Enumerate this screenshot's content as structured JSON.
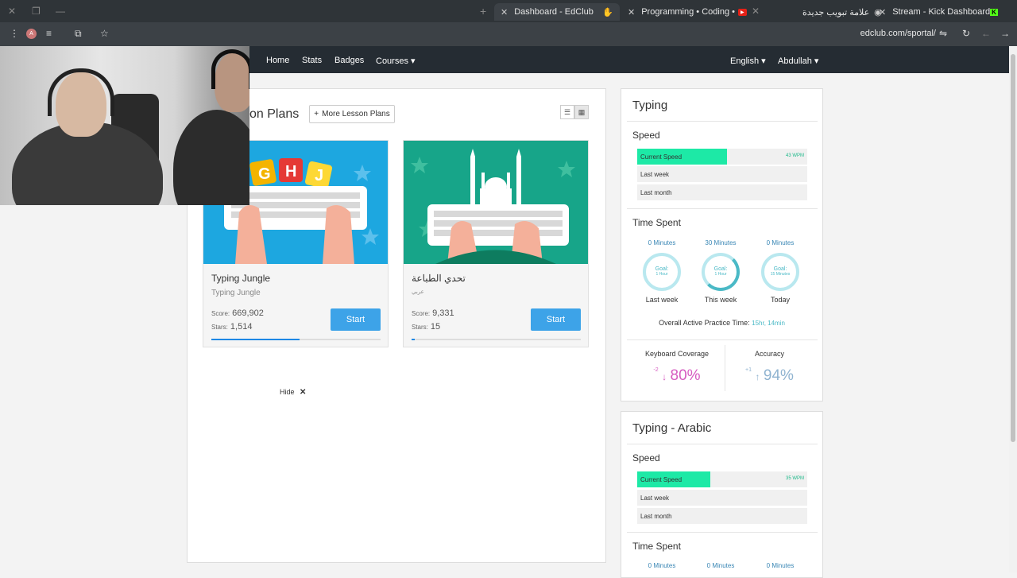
{
  "browser": {
    "tabs": [
      {
        "label": "Dashboard - EdClub",
        "active": true
      },
      {
        "label": "Programming  •  Coding  •",
        "active": false
      },
      {
        "label": "علامة تبويب جديدة",
        "active": false
      },
      {
        "label": "Stream - Kick Dashboard",
        "active": false
      }
    ],
    "url": "edclub.com/sportal/"
  },
  "nav": {
    "home": "Home",
    "stats": "Stats",
    "badges": "Badges",
    "courses": "Courses ▾",
    "language": "English ▾",
    "user": "Abdullah ▾"
  },
  "lessons": {
    "title": "on Plans",
    "more_button": "More Lesson Plans",
    "cards": [
      {
        "title": "Typing Jungle",
        "subtitle": "Typing Jungle",
        "score_label": "Score:",
        "score": "669,902",
        "stars_label": "Stars:",
        "stars": "1,514",
        "start": "Start",
        "progress": 0.52
      },
      {
        "title": "تحدي الطباعة",
        "subtitle": "عربي",
        "score_label": "Score:",
        "score": "9,331",
        "stars_label": "Stars:",
        "stars": "15",
        "start": "Start",
        "progress": 0.02
      }
    ],
    "hide": "Hide"
  },
  "typing": {
    "title": "Typing",
    "speed_title": "Speed",
    "speed_rows": [
      {
        "label": "Current Speed",
        "wpm": "43 WPM",
        "fill": 0.53
      },
      {
        "label": "Last week",
        "wpm": "",
        "fill": 0
      },
      {
        "label": "Last month",
        "wpm": "",
        "fill": 0
      }
    ],
    "time_title": "Time Spent",
    "time_cols": [
      {
        "minutes": "0 Minutes",
        "goal": "Goal:",
        "goal_value": "1 Hour",
        "label": "Last week"
      },
      {
        "minutes": "30 Minutes",
        "goal": "Goal:",
        "goal_value": "1 Hour",
        "label": "This week"
      },
      {
        "minutes": "0 Minutes",
        "goal": "Goal:",
        "goal_value": "15 Minutes",
        "label": "Today"
      }
    ],
    "practice_label": "Overall Active Practice Time:",
    "practice_value": "15hr, 14min",
    "coverage_label": "Keyboard Coverage",
    "coverage_delta": "-2",
    "coverage_value": "80%",
    "accuracy_label": "Accuracy",
    "accuracy_delta": "+1",
    "accuracy_value": "94%"
  },
  "arabic": {
    "title": "Typing - Arabic",
    "speed_title": "Speed",
    "speed_rows": [
      {
        "label": "Current Speed",
        "wpm": "35 WPM",
        "fill": 0.43
      },
      {
        "label": "Last week",
        "wpm": "",
        "fill": 0
      },
      {
        "label": "Last month",
        "wpm": "",
        "fill": 0
      }
    ],
    "time_title": "Time Spent",
    "time_cols": [
      {
        "minutes": "0 Minutes"
      },
      {
        "minutes": "0 Minutes"
      },
      {
        "minutes": "0 Minutes"
      }
    ]
  },
  "colors": {
    "accent": "#3da3e8",
    "speed": "#1de9a6",
    "coverage": "#d65bc0",
    "accuracy": "#8fb3d0"
  }
}
